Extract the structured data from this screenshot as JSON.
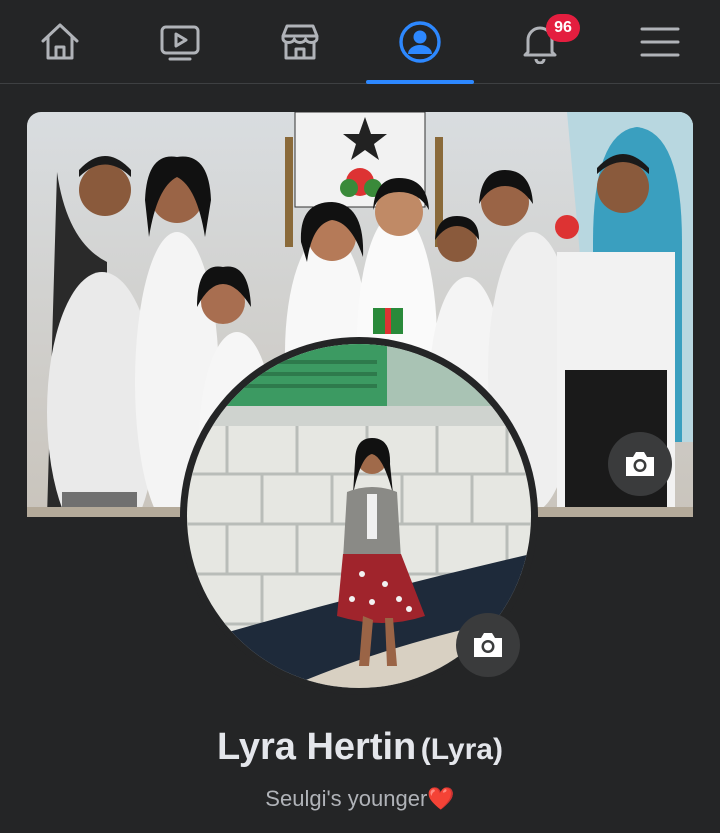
{
  "nav": {
    "tabs": [
      {
        "name": "home",
        "icon": "home-icon"
      },
      {
        "name": "watch",
        "icon": "video-icon"
      },
      {
        "name": "marketplace",
        "icon": "store-icon"
      },
      {
        "name": "profile",
        "icon": "profile-icon",
        "active": true
      },
      {
        "name": "notifications",
        "icon": "bell-icon",
        "badge": "96"
      },
      {
        "name": "menu",
        "icon": "hamburger-menu-icon"
      }
    ],
    "notification_count": "96"
  },
  "profile": {
    "name": "Lyra Hertin",
    "alternate_name": "(Lyra)",
    "bio": "Seulgi's younger",
    "bio_emoji": "❤️"
  },
  "colors": {
    "background": "#242526",
    "active_tab": "#2d88ff",
    "badge": "#e41e3f",
    "camera_button": "#3a3b3c"
  }
}
